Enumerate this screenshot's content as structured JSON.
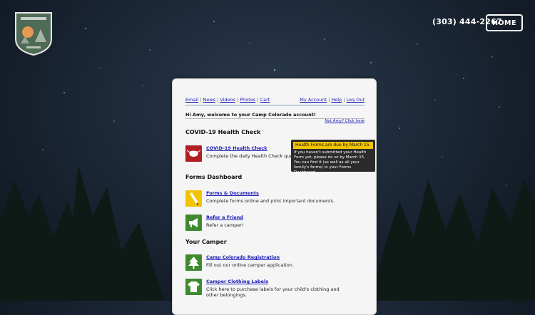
{
  "header": {
    "logo_text": "CAMP COLORADO",
    "logo_subtext": "EST. 2001",
    "phone": "(303) 444-2267",
    "home_button": "HOME"
  },
  "nav": {
    "left_links": [
      "Email",
      "News",
      "Videos",
      "Photos",
      "Cart"
    ],
    "right_links": [
      "My Account",
      "Help",
      "Log Out"
    ]
  },
  "welcome": "Hi Amy, welcome to your Camp Colorado account!",
  "not_amy": "Not Amy? Click here",
  "sections": {
    "covid": "COVID-19 Health Check",
    "forms": "Forms Dashboard",
    "camper": "Your Camper"
  },
  "items": {
    "covid": {
      "title": "COVID-19 Health Check",
      "desc": "Complete the daily Health Check questionnaire."
    },
    "forms": {
      "title": "Forms & Documents",
      "desc": "Complete forms online and print important documents."
    },
    "refer": {
      "title": "Refer a Friend",
      "desc": "Refer a camper!"
    },
    "registration": {
      "title": "Camp Colorado Registration",
      "desc": "Fill out our online camper application."
    },
    "labels": {
      "title": "Camper Clothing Labels",
      "desc": "Click here to purchase labels for your child's clothing and other belongings."
    }
  },
  "notice": {
    "heading": "Health Forms are due by March 15",
    "body": "If you haven't submitted your Health Form yet, please do so by March 15. You can find it (as well as all your family's forms) in your Forms Dashboard."
  },
  "colors": {
    "link": "#1a1ab5",
    "notice_bar": "#f2c400",
    "icon_red": "#b11f24",
    "icon_yellow": "#f2c400",
    "icon_green": "#3f8a2e"
  },
  "icons": {
    "covid": "mask-icon",
    "forms": "pencil-icon",
    "refer": "megaphone-icon",
    "registration": "tree-icon",
    "labels": "shirt-icon"
  }
}
